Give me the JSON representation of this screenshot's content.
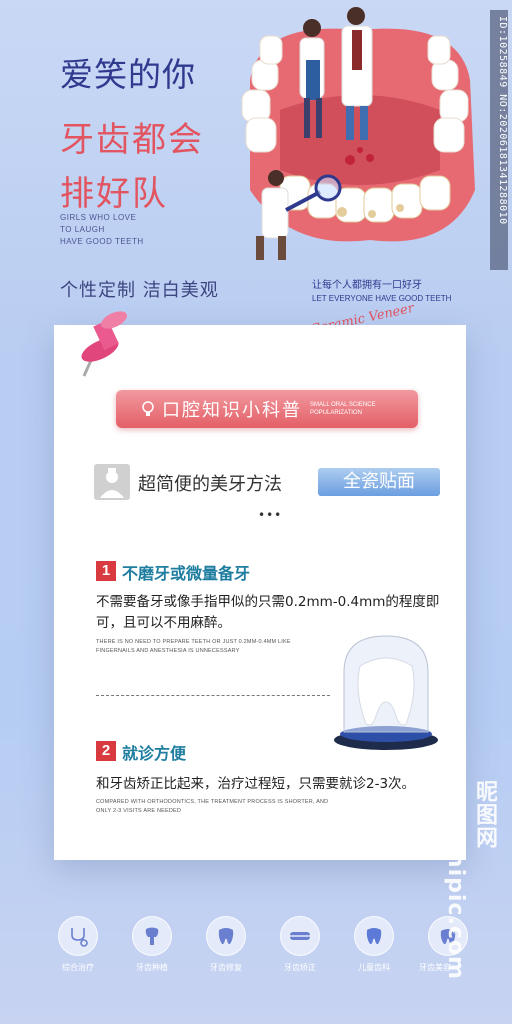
{
  "header": {
    "title_line1": "爱笑的你",
    "title_line2": "牙齿都会",
    "title_line3": "排好队",
    "english": [
      "GIRLS WHO LOVE",
      "TO LAUGH",
      "HAVE GOOD TEETH"
    ],
    "slogan": "个性定制  洁白美观",
    "slogan_right_cn": "让每个人都拥有一口好牙",
    "slogan_right_en": "LET EVERYONE HAVE GOOD TEETH",
    "script": "All Ceramic Veneer"
  },
  "side_id": "ID:10258849 NO:20206181341288010",
  "watermark": "昵图网 www.nipic.com",
  "card": {
    "banner_title": "口腔知识小科普",
    "banner_sub": [
      "SMALL ORAL SCIENCE",
      "POPULARIZATION"
    ],
    "method_title": "超简便的美牙方法",
    "method_tag": "全瓷贴面",
    "dots": "•••",
    "items": [
      {
        "num": "1",
        "heading": "不磨牙或微量备牙",
        "body": "不需要备牙或像手指甲似的只需0.2mm-0.4mm的程度即可，且可以不用麻醉。",
        "en": "THERE IS NO NEED TO PREPARE TEETH OR JUST 0.2MM-0.4MM LIKE FINGERNAILS AND ANESTHESIA IS UNNECESSARY"
      },
      {
        "num": "2",
        "heading": "就诊方便",
        "body": "和牙齿矫正比起来，治疗过程短，只需要就诊2-3次。",
        "en": "COMPARED WITH ORTHODONTICS, THE TREATMENT PROCESS IS SHORTER, AND ONLY 2-3 VISITS ARE NEEDED"
      }
    ]
  },
  "bottom_nav": [
    {
      "label": "综合治疗",
      "icon": "stethoscope-icon"
    },
    {
      "label": "牙齿种植",
      "icon": "implant-icon"
    },
    {
      "label": "牙齿修复",
      "icon": "tooth-icon"
    },
    {
      "label": "牙齿矫正",
      "icon": "braces-icon"
    },
    {
      "label": "儿童齿科",
      "icon": "tooth-icon"
    },
    {
      "label": "牙齿美容",
      "icon": "sparkle-tooth-icon"
    }
  ],
  "colors": {
    "title_blue": "#2f3a8f",
    "accent_red": "#e2545f",
    "heading_teal": "#1f7ea0",
    "number_red": "#d83a3f"
  }
}
